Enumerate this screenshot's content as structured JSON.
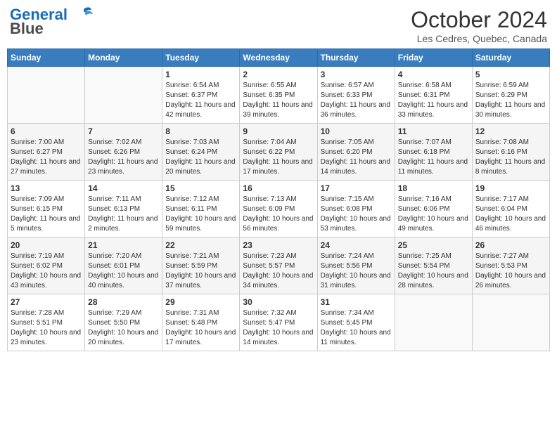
{
  "header": {
    "logo_line1": "General",
    "logo_line2": "Blue",
    "month": "October 2024",
    "location": "Les Cedres, Quebec, Canada"
  },
  "days_of_week": [
    "Sunday",
    "Monday",
    "Tuesday",
    "Wednesday",
    "Thursday",
    "Friday",
    "Saturday"
  ],
  "weeks": [
    [
      {
        "day": "",
        "info": ""
      },
      {
        "day": "",
        "info": ""
      },
      {
        "day": "1",
        "info": "Sunrise: 6:54 AM\nSunset: 6:37 PM\nDaylight: 11 hours and 42 minutes."
      },
      {
        "day": "2",
        "info": "Sunrise: 6:55 AM\nSunset: 6:35 PM\nDaylight: 11 hours and 39 minutes."
      },
      {
        "day": "3",
        "info": "Sunrise: 6:57 AM\nSunset: 6:33 PM\nDaylight: 11 hours and 36 minutes."
      },
      {
        "day": "4",
        "info": "Sunrise: 6:58 AM\nSunset: 6:31 PM\nDaylight: 11 hours and 33 minutes."
      },
      {
        "day": "5",
        "info": "Sunrise: 6:59 AM\nSunset: 6:29 PM\nDaylight: 11 hours and 30 minutes."
      }
    ],
    [
      {
        "day": "6",
        "info": "Sunrise: 7:00 AM\nSunset: 6:27 PM\nDaylight: 11 hours and 27 minutes."
      },
      {
        "day": "7",
        "info": "Sunrise: 7:02 AM\nSunset: 6:26 PM\nDaylight: 11 hours and 23 minutes."
      },
      {
        "day": "8",
        "info": "Sunrise: 7:03 AM\nSunset: 6:24 PM\nDaylight: 11 hours and 20 minutes."
      },
      {
        "day": "9",
        "info": "Sunrise: 7:04 AM\nSunset: 6:22 PM\nDaylight: 11 hours and 17 minutes."
      },
      {
        "day": "10",
        "info": "Sunrise: 7:05 AM\nSunset: 6:20 PM\nDaylight: 11 hours and 14 minutes."
      },
      {
        "day": "11",
        "info": "Sunrise: 7:07 AM\nSunset: 6:18 PM\nDaylight: 11 hours and 11 minutes."
      },
      {
        "day": "12",
        "info": "Sunrise: 7:08 AM\nSunset: 6:16 PM\nDaylight: 11 hours and 8 minutes."
      }
    ],
    [
      {
        "day": "13",
        "info": "Sunrise: 7:09 AM\nSunset: 6:15 PM\nDaylight: 11 hours and 5 minutes."
      },
      {
        "day": "14",
        "info": "Sunrise: 7:11 AM\nSunset: 6:13 PM\nDaylight: 11 hours and 2 minutes."
      },
      {
        "day": "15",
        "info": "Sunrise: 7:12 AM\nSunset: 6:11 PM\nDaylight: 10 hours and 59 minutes."
      },
      {
        "day": "16",
        "info": "Sunrise: 7:13 AM\nSunset: 6:09 PM\nDaylight: 10 hours and 56 minutes."
      },
      {
        "day": "17",
        "info": "Sunrise: 7:15 AM\nSunset: 6:08 PM\nDaylight: 10 hours and 53 minutes."
      },
      {
        "day": "18",
        "info": "Sunrise: 7:16 AM\nSunset: 6:06 PM\nDaylight: 10 hours and 49 minutes."
      },
      {
        "day": "19",
        "info": "Sunrise: 7:17 AM\nSunset: 6:04 PM\nDaylight: 10 hours and 46 minutes."
      }
    ],
    [
      {
        "day": "20",
        "info": "Sunrise: 7:19 AM\nSunset: 6:02 PM\nDaylight: 10 hours and 43 minutes."
      },
      {
        "day": "21",
        "info": "Sunrise: 7:20 AM\nSunset: 6:01 PM\nDaylight: 10 hours and 40 minutes."
      },
      {
        "day": "22",
        "info": "Sunrise: 7:21 AM\nSunset: 5:59 PM\nDaylight: 10 hours and 37 minutes."
      },
      {
        "day": "23",
        "info": "Sunrise: 7:23 AM\nSunset: 5:57 PM\nDaylight: 10 hours and 34 minutes."
      },
      {
        "day": "24",
        "info": "Sunrise: 7:24 AM\nSunset: 5:56 PM\nDaylight: 10 hours and 31 minutes."
      },
      {
        "day": "25",
        "info": "Sunrise: 7:25 AM\nSunset: 5:54 PM\nDaylight: 10 hours and 28 minutes."
      },
      {
        "day": "26",
        "info": "Sunrise: 7:27 AM\nSunset: 5:53 PM\nDaylight: 10 hours and 26 minutes."
      }
    ],
    [
      {
        "day": "27",
        "info": "Sunrise: 7:28 AM\nSunset: 5:51 PM\nDaylight: 10 hours and 23 minutes."
      },
      {
        "day": "28",
        "info": "Sunrise: 7:29 AM\nSunset: 5:50 PM\nDaylight: 10 hours and 20 minutes."
      },
      {
        "day": "29",
        "info": "Sunrise: 7:31 AM\nSunset: 5:48 PM\nDaylight: 10 hours and 17 minutes."
      },
      {
        "day": "30",
        "info": "Sunrise: 7:32 AM\nSunset: 5:47 PM\nDaylight: 10 hours and 14 minutes."
      },
      {
        "day": "31",
        "info": "Sunrise: 7:34 AM\nSunset: 5:45 PM\nDaylight: 10 hours and 11 minutes."
      },
      {
        "day": "",
        "info": ""
      },
      {
        "day": "",
        "info": ""
      }
    ]
  ]
}
